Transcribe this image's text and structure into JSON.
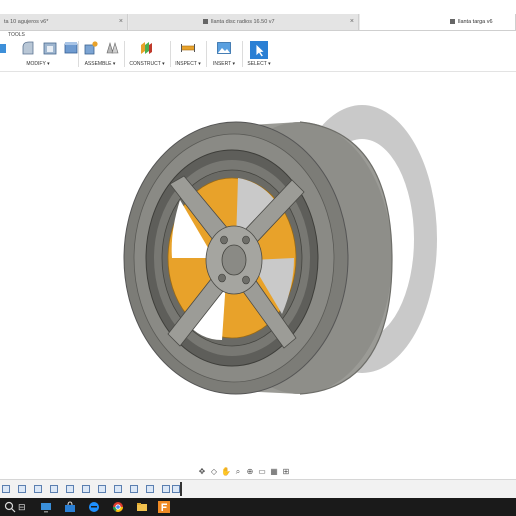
{
  "tabs": [
    {
      "label": "ta 10 agujeros v6*",
      "close": "×",
      "active": false
    },
    {
      "label": "llanta disc radios 16.50 v7",
      "close": "×",
      "active": false
    },
    {
      "label": "llanta targa v6",
      "close": "×",
      "active": true
    }
  ],
  "toolbar": {
    "section_label": "TOOLS",
    "groups": [
      {
        "label": "MODIFY ▾"
      },
      {
        "label": "ASSEMBLE ▾"
      },
      {
        "label": "CONSTRUCT ▾"
      },
      {
        "label": "INSPECT ▾"
      },
      {
        "label": "INSERT ▾"
      },
      {
        "label": "SELECT ▾"
      }
    ]
  },
  "taskbar": {
    "task_view_label": "⊟"
  },
  "colors": {
    "accent_orange": "#e8a22a",
    "tire_gray": "#8a8a86",
    "rim_dark": "#4a4a46",
    "select_blue": "#2a7fd4"
  },
  "icons": [
    "modify-icons",
    "assemble-icons",
    "construct-icon",
    "inspect-measure-icon",
    "insert-image-icon",
    "select-arrow-icon"
  ]
}
